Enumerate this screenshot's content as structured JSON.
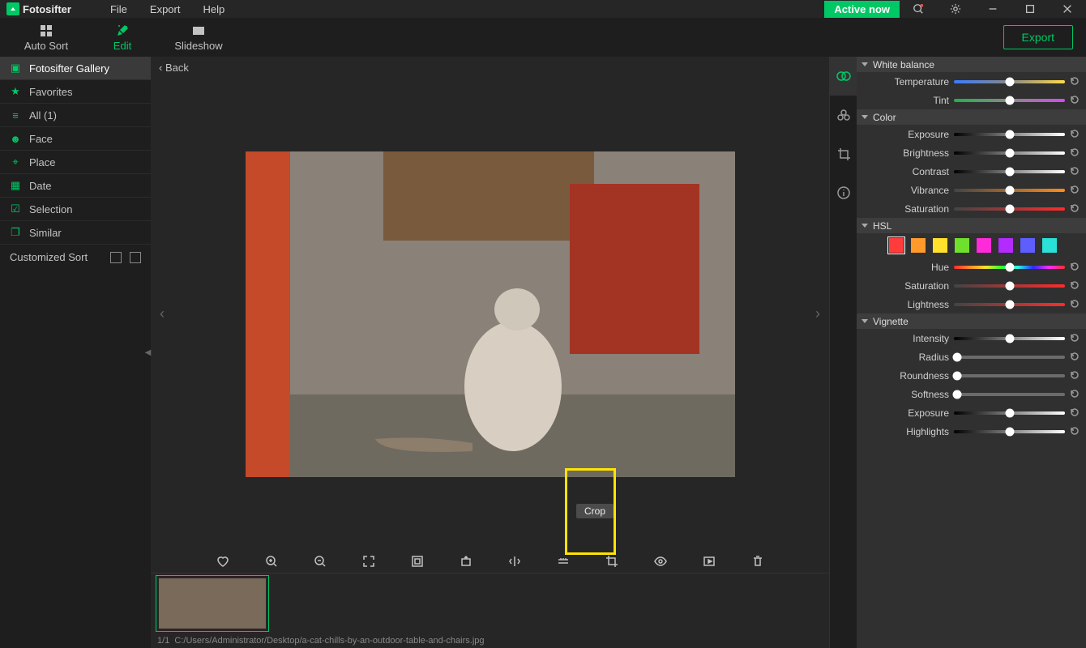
{
  "title": {
    "logo_text": "Fotosifter"
  },
  "menu": {
    "file": "File",
    "export": "Export",
    "help": "Help"
  },
  "active_badge": "Active now",
  "tabs": {
    "auto_sort": "Auto Sort",
    "edit": "Edit",
    "slideshow": "Slideshow"
  },
  "export_btn": "Export",
  "sidebar": {
    "items": [
      {
        "label": "Fotosifter Gallery"
      },
      {
        "label": "Favorites"
      },
      {
        "label": "All (1)"
      },
      {
        "label": "Face"
      },
      {
        "label": "Place"
      },
      {
        "label": "Date"
      },
      {
        "label": "Selection"
      },
      {
        "label": "Similar"
      }
    ],
    "custom_sort": "Customized Sort"
  },
  "viewer": {
    "back": "Back",
    "counter": "1/1",
    "path": "C:/Users/Administrator/Desktop/a-cat-chills-by-an-outdoor-table-and-chairs.jpg",
    "crop_tooltip": "Crop"
  },
  "panels": {
    "wb": {
      "title": "White balance",
      "temperature": "Temperature",
      "tint": "Tint"
    },
    "color": {
      "title": "Color",
      "exposure": "Exposure",
      "brightness": "Brightness",
      "contrast": "Contrast",
      "vibrance": "Vibrance",
      "saturation": "Saturation"
    },
    "hsl": {
      "title": "HSL",
      "hue": "Hue",
      "saturation": "Saturation",
      "lightness": "Lightness"
    },
    "vignette": {
      "title": "Vignette",
      "intensity": "Intensity",
      "radius": "Radius",
      "roundness": "Roundness",
      "softness": "Softness",
      "exposure": "Exposure",
      "highlights": "Highlights"
    }
  },
  "colors": {
    "hsl_swatches": [
      "#ff3b3b",
      "#ff9a2b",
      "#ffe02b",
      "#6fe02b",
      "#ff2bd9",
      "#b22bff",
      "#5e5eff",
      "#2be0d6"
    ],
    "temp_grad": "linear-gradient(90deg,#3a7bff,#888,#ffda4a)",
    "tint_grad": "linear-gradient(90deg,#1fb24a,#888,#d24af0)",
    "exp_grad": "linear-gradient(90deg,#000,#fff)",
    "vib_grad": "linear-gradient(90deg,#444,#ff8c1a)",
    "sat_grad": "linear-gradient(90deg,#444,#ff2b2b)",
    "hue_grad": "linear-gradient(90deg,#ff2b2b,#ff8c2b,#ffe02b,#2bff2b,#2bffe0,#2b2bff,#ff2bff,#ff2b2b)"
  }
}
